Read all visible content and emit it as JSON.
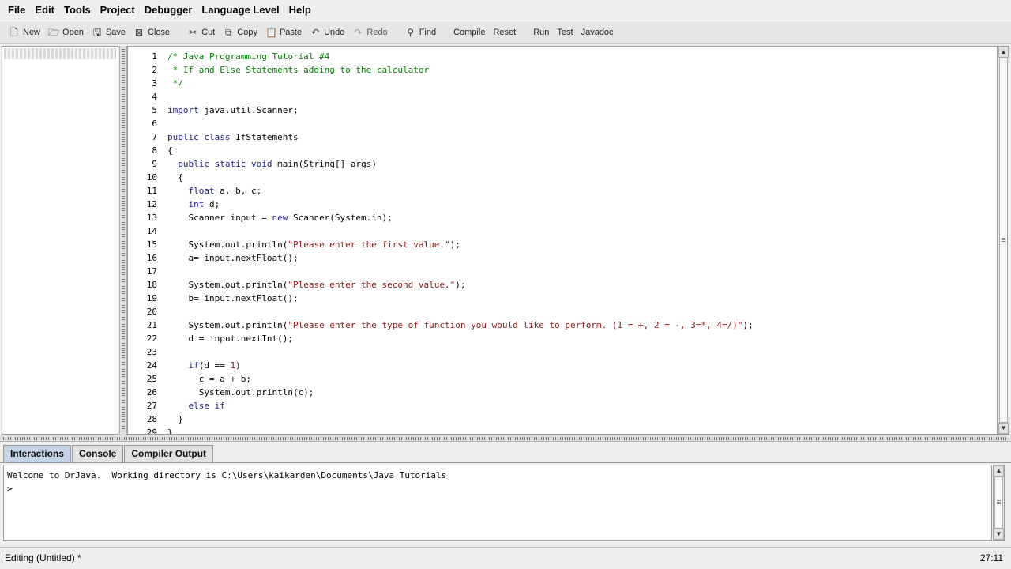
{
  "menubar": {
    "items": [
      {
        "label": "File"
      },
      {
        "label": "Edit"
      },
      {
        "label": "Tools"
      },
      {
        "label": "Project"
      },
      {
        "label": "Debugger"
      },
      {
        "label": "Language Level"
      },
      {
        "label": "Help"
      }
    ]
  },
  "toolbar": {
    "new": "New",
    "open": "Open",
    "save": "Save",
    "close": "Close",
    "cut": "Cut",
    "copy": "Copy",
    "paste": "Paste",
    "undo": "Undo",
    "redo": "Redo",
    "find": "Find",
    "compile": "Compile",
    "reset": "Reset",
    "run": "Run",
    "test": "Test",
    "javadoc": "Javadoc"
  },
  "editor": {
    "lines": [
      {
        "n": "1",
        "text": "/* Java Programming Tutorial #4"
      },
      {
        "n": "2",
        "text": " * If and Else Statements adding to the calculator"
      },
      {
        "n": "3",
        "text": " */"
      },
      {
        "n": "4",
        "text": ""
      },
      {
        "n": "5",
        "text": "import java.util.Scanner;"
      },
      {
        "n": "6",
        "text": ""
      },
      {
        "n": "7",
        "text": "public class IfStatements"
      },
      {
        "n": "8",
        "text": "{"
      },
      {
        "n": "9",
        "text": "  public static void main(String[] args)"
      },
      {
        "n": "10",
        "text": "  {"
      },
      {
        "n": "11",
        "text": "    float a, b, c;"
      },
      {
        "n": "12",
        "text": "    int d;"
      },
      {
        "n": "13",
        "text": "    Scanner input = new Scanner(System.in);"
      },
      {
        "n": "14",
        "text": ""
      },
      {
        "n": "15",
        "text": "    System.out.println(\"Please enter the first value.\");"
      },
      {
        "n": "16",
        "text": "    a= input.nextFloat();"
      },
      {
        "n": "17",
        "text": ""
      },
      {
        "n": "18",
        "text": "    System.out.println(\"Please enter the second value.\");"
      },
      {
        "n": "19",
        "text": "    b= input.nextFloat();"
      },
      {
        "n": "20",
        "text": ""
      },
      {
        "n": "21",
        "text": "    System.out.println(\"Please enter the type of function you would like to perform. (1 = +, 2 = -, 3=*, 4=/)\");"
      },
      {
        "n": "22",
        "text": "    d = input.nextInt();"
      },
      {
        "n": "23",
        "text": ""
      },
      {
        "n": "24",
        "text": "    if(d == 1)"
      },
      {
        "n": "25",
        "text": "      c = a + b;"
      },
      {
        "n": "26",
        "text": "      System.out.println(c);"
      },
      {
        "n": "27",
        "text": "    else if"
      },
      {
        "n": "28",
        "text": "  }"
      },
      {
        "n": "29",
        "text": "}"
      }
    ]
  },
  "tabs": {
    "interactions": "Interactions",
    "console": "Console",
    "compiler_output": "Compiler Output"
  },
  "interactions": {
    "welcome": "Welcome to DrJava.  Working directory is C:\\Users\\kaikarden\\Documents\\Java Tutorials",
    "prompt": ">"
  },
  "status": {
    "left": "Editing (Untitled) *",
    "right": "27:11"
  },
  "colors": {
    "comment": "#008000",
    "keyword": "#1c1c8c",
    "string": "#8b1a1a",
    "active_tab": "#c4d4e6"
  }
}
